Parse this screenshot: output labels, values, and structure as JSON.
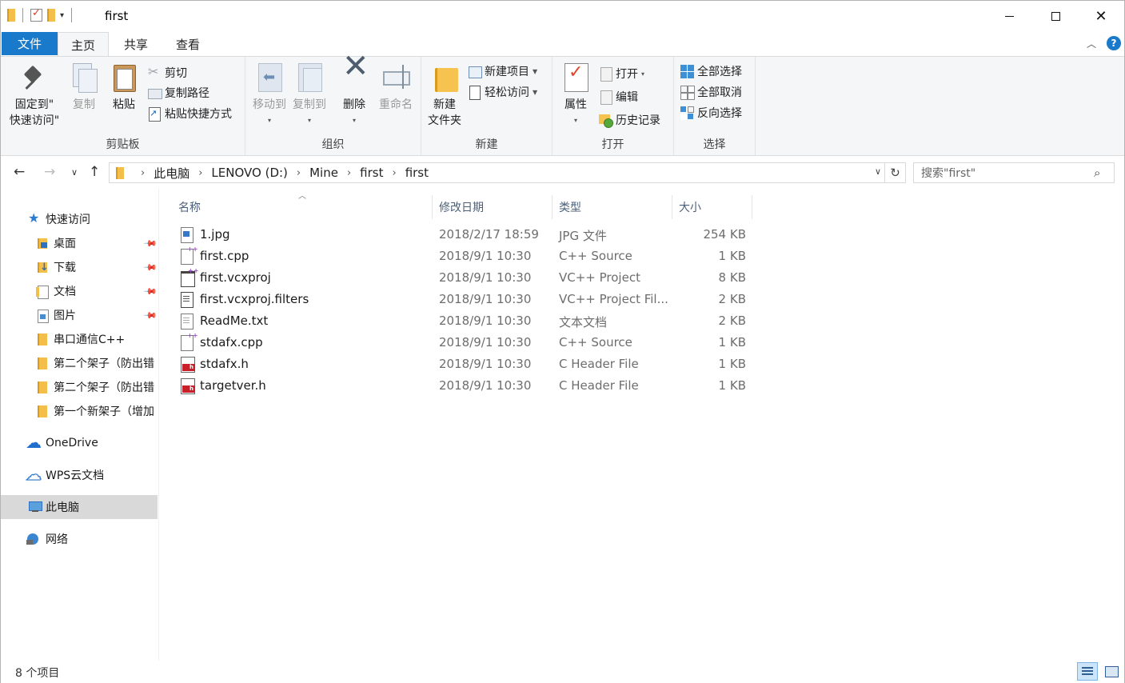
{
  "window": {
    "title": "first",
    "controls": {
      "minimize": "",
      "maximize": "",
      "close": "✕"
    }
  },
  "ribbon_tabs": [
    {
      "label": "文件"
    },
    {
      "label": "主页"
    },
    {
      "label": "共享"
    },
    {
      "label": "查看"
    }
  ],
  "ribbon": {
    "clipboard": {
      "group_label": "剪贴板",
      "pin_quick_access_line1": "固定到\"",
      "pin_quick_access_line2": "快速访问\"",
      "copy": "复制",
      "paste": "粘贴",
      "cut": "剪切",
      "copy_path": "复制路径",
      "paste_shortcut": "粘贴快捷方式"
    },
    "organize": {
      "group_label": "组织",
      "move_to": "移动到",
      "copy_to": "复制到",
      "delete": "删除",
      "rename": "重命名"
    },
    "new": {
      "group_label": "新建",
      "new_folder_line1": "新建",
      "new_folder_line2": "文件夹",
      "new_item": "新建项目",
      "easy_access": "轻松访问"
    },
    "open": {
      "group_label": "打开",
      "properties": "属性",
      "open": "打开",
      "edit": "编辑",
      "history": "历史记录"
    },
    "select": {
      "group_label": "选择",
      "select_all": "全部选择",
      "select_none": "全部取消",
      "invert": "反向选择"
    }
  },
  "address_bar": {
    "crumbs": [
      "此电脑",
      "LENOVO (D:)",
      "Mine",
      "first",
      "first"
    ],
    "search_placeholder": "搜索\"first\""
  },
  "sidebar": {
    "items": [
      {
        "label": "快速访问",
        "icon": "star-icon"
      },
      {
        "label": "桌面",
        "icon": "desktop-folder-icon",
        "pinned": true
      },
      {
        "label": "下载",
        "icon": "downloads-folder-icon",
        "pinned": true
      },
      {
        "label": "文档",
        "icon": "documents-folder-icon",
        "pinned": true
      },
      {
        "label": "图片",
        "icon": "pictures-folder-icon",
        "pinned": true
      },
      {
        "label": "串口通信C++",
        "icon": "folder-icon"
      },
      {
        "label": "第二个架子（防出错",
        "icon": "folder-icon"
      },
      {
        "label": "第二个架子（防出错",
        "icon": "folder-icon"
      },
      {
        "label": "第一个新架子（增加",
        "icon": "folder-icon"
      },
      {
        "label": "OneDrive",
        "icon": "onedrive-cloud-icon"
      },
      {
        "label": "WPS云文档",
        "icon": "wps-cloud-icon"
      },
      {
        "label": "此电脑",
        "icon": "this-pc-icon",
        "selected": true
      },
      {
        "label": "网络",
        "icon": "network-icon"
      }
    ]
  },
  "file_list": {
    "columns": {
      "name": "名称",
      "date": "修改日期",
      "type": "类型",
      "size": "大小"
    },
    "rows": [
      {
        "name": "1.jpg",
        "date": "2018/2/17 18:59",
        "type": "JPG 文件",
        "size": "254 KB",
        "icon": "image-file-icon"
      },
      {
        "name": "first.cpp",
        "date": "2018/9/1 10:30",
        "type": "C++ Source",
        "size": "1 KB",
        "icon": "cpp-file-icon"
      },
      {
        "name": "first.vcxproj",
        "date": "2018/9/1 10:30",
        "type": "VC++ Project",
        "size": "8 KB",
        "icon": "vcxproj-file-icon"
      },
      {
        "name": "first.vcxproj.filters",
        "date": "2018/9/1 10:30",
        "type": "VC++ Project Fil...",
        "size": "2 KB",
        "icon": "filters-file-icon"
      },
      {
        "name": "ReadMe.txt",
        "date": "2018/9/1 10:30",
        "type": "文本文档",
        "size": "2 KB",
        "icon": "text-file-icon"
      },
      {
        "name": "stdafx.cpp",
        "date": "2018/9/1 10:30",
        "type": "C++ Source",
        "size": "1 KB",
        "icon": "cpp-file-icon"
      },
      {
        "name": "stdafx.h",
        "date": "2018/9/1 10:30",
        "type": "C Header File",
        "size": "1 KB",
        "icon": "header-file-icon"
      },
      {
        "name": "targetver.h",
        "date": "2018/9/1 10:30",
        "type": "C Header File",
        "size": "1 KB",
        "icon": "header-file-icon"
      }
    ]
  },
  "status_bar": {
    "item_count": "8 个项目"
  },
  "colors": {
    "accent": "#1979ca",
    "ribbon_bg": "#f5f6f7",
    "selected_nav": "#d9d9d9",
    "header_text": "#4c607a"
  }
}
